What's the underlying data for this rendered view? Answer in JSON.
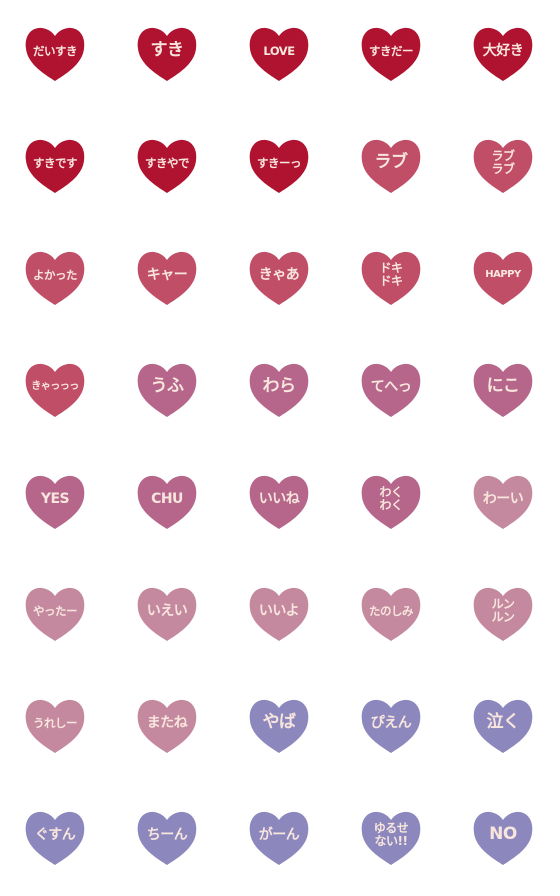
{
  "colors": {
    "text": "#f8e6de",
    "dark_red": "#b0132f",
    "rose": "#c04e66",
    "mauve": "#b5668a",
    "light_mauve": "#c4899f",
    "lavender": "#8c87bd"
  },
  "stickers": [
    {
      "text": "だいすき",
      "color": "dark_red"
    },
    {
      "text": "すき",
      "color": "dark_red"
    },
    {
      "text": "LOVE",
      "color": "dark_red"
    },
    {
      "text": "すきだー",
      "color": "dark_red"
    },
    {
      "text": "大好き",
      "color": "dark_red"
    },
    {
      "text": "すきです",
      "color": "dark_red"
    },
    {
      "text": "すきやで",
      "color": "dark_red"
    },
    {
      "text": "すきーっ",
      "color": "dark_red"
    },
    {
      "text": "ラブ",
      "color": "rose"
    },
    {
      "text": "ラブ\nラブ",
      "color": "rose"
    },
    {
      "text": "よかった",
      "color": "rose"
    },
    {
      "text": "キャー",
      "color": "rose"
    },
    {
      "text": "きゃあ",
      "color": "rose"
    },
    {
      "text": "ドキ\nドキ",
      "color": "rose"
    },
    {
      "text": "HAPPY",
      "color": "rose"
    },
    {
      "text": "きゃっっっ",
      "color": "rose"
    },
    {
      "text": "うふ",
      "color": "mauve"
    },
    {
      "text": "わら",
      "color": "mauve"
    },
    {
      "text": "てへっ",
      "color": "mauve"
    },
    {
      "text": "にこ",
      "color": "mauve"
    },
    {
      "text": "YES",
      "color": "mauve"
    },
    {
      "text": "CHU",
      "color": "mauve"
    },
    {
      "text": "いいね",
      "color": "mauve"
    },
    {
      "text": "わく\nわく",
      "color": "mauve"
    },
    {
      "text": "わーい",
      "color": "light_mauve"
    },
    {
      "text": "やったー",
      "color": "light_mauve"
    },
    {
      "text": "いえい",
      "color": "light_mauve"
    },
    {
      "text": "いいよ",
      "color": "light_mauve"
    },
    {
      "text": "たのしみ",
      "color": "light_mauve"
    },
    {
      "text": "ルン\nルン",
      "color": "light_mauve"
    },
    {
      "text": "うれしー",
      "color": "light_mauve"
    },
    {
      "text": "またね",
      "color": "light_mauve"
    },
    {
      "text": "やば",
      "color": "lavender"
    },
    {
      "text": "ぴえん",
      "color": "lavender"
    },
    {
      "text": "泣く",
      "color": "lavender"
    },
    {
      "text": "ぐすん",
      "color": "lavender"
    },
    {
      "text": "ちーん",
      "color": "lavender"
    },
    {
      "text": "がーん",
      "color": "lavender"
    },
    {
      "text": "ゆるせ\nない!!",
      "color": "lavender"
    },
    {
      "text": "NO",
      "color": "lavender"
    }
  ]
}
